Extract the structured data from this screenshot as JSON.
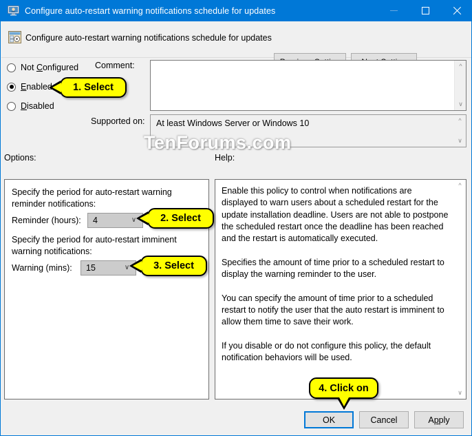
{
  "window": {
    "title": "Configure auto-restart warning notifications schedule for updates",
    "title_icon": "computer-policy-icon",
    "caption_buttons": {
      "minimize": "minimize-icon",
      "maximize": "maximize-icon",
      "close": "close-icon"
    },
    "accent_color": "#0078d7",
    "chrome_color": "#f0f0f0"
  },
  "header": {
    "icon": "policy-setting-icon",
    "title": "Configure auto-restart warning notifications schedule for updates",
    "previous_setting_label": "Previous Setting",
    "next_setting_label": "Next Setting"
  },
  "state": {
    "radio_options": [
      {
        "label_pre": "Not ",
        "accel": "C",
        "label_post": "onfigured",
        "checked": false,
        "name": "not-configured"
      },
      {
        "label_pre": "",
        "accel": "E",
        "label_post": "nabled",
        "checked": true,
        "name": "enabled"
      },
      {
        "label_pre": "",
        "accel": "D",
        "label_post": "isabled",
        "checked": false,
        "name": "disabled"
      }
    ]
  },
  "comment": {
    "label": "Comment:",
    "value": ""
  },
  "supported": {
    "label": "Supported on:",
    "value": "At least Windows Server or Windows 10"
  },
  "panels": {
    "options_label": "Options:",
    "help_label": "Help:"
  },
  "options": {
    "text_1": "Specify the period for auto-restart warning reminder notifications:",
    "reminder": {
      "label": "Reminder (hours):",
      "value": "4"
    },
    "text_2": "Specify the period for auto-restart imminent warning notifications:",
    "warning": {
      "label": "Warning (mins):",
      "value": "15"
    }
  },
  "help": {
    "text": "Enable this policy to control when notifications are displayed to warn users about a scheduled restart for the update installation deadline. Users are not able to postpone the scheduled restart once the deadline has been reached and the restart is automatically executed.\n\nSpecifies the amount of time prior to a scheduled restart to display the warning reminder to the user.\n\nYou can specify the amount of time prior to a scheduled restart to notify the user that the auto restart is imminent to allow them time to save their work.\n\nIf you disable or do not configure this policy, the default notification behaviors will be used."
  },
  "footer": {
    "ok_label": "OK",
    "cancel_label": "Cancel",
    "apply_pre": "A",
    "apply_accel": "p",
    "apply_post": "ply",
    "apply_label": "Apply"
  },
  "watermark": {
    "text": "TenForums.com"
  },
  "callouts": [
    {
      "name": "callout-select-enabled",
      "text": "1. Select"
    },
    {
      "name": "callout-select-reminder",
      "text": "2. Select"
    },
    {
      "name": "callout-select-warning",
      "text": "3. Select"
    },
    {
      "name": "callout-click-ok",
      "text": "4. Click on"
    }
  ]
}
